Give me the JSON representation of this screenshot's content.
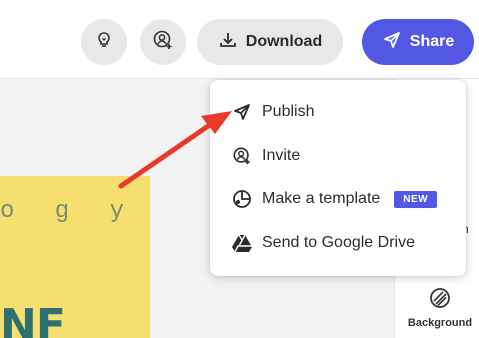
{
  "toolbar": {
    "idea_icon": "lightbulb-icon",
    "add_user_icon": "add-user-icon",
    "download_label": "Download",
    "download_icon": "download-icon",
    "share_label": "Share",
    "share_icon": "send-icon"
  },
  "canvas": {
    "design_text_top": "o g y",
    "design_text_bottom": "NF"
  },
  "side_panel": {
    "fragment_label": "n",
    "background_label": "Background",
    "background_icon": "hatch-icon"
  },
  "share_menu": {
    "items": [
      {
        "label": "Publish",
        "icon": "send-icon"
      },
      {
        "label": "Invite",
        "icon": "add-user-icon"
      },
      {
        "label": "Make a template",
        "icon": "template-icon",
        "badge": "NEW"
      },
      {
        "label": "Send to Google Drive",
        "icon": "google-drive-icon"
      }
    ]
  },
  "colors": {
    "accent": "#5258e4",
    "annotation_arrow": "#e8392a",
    "design_background": "#f7df6f"
  }
}
